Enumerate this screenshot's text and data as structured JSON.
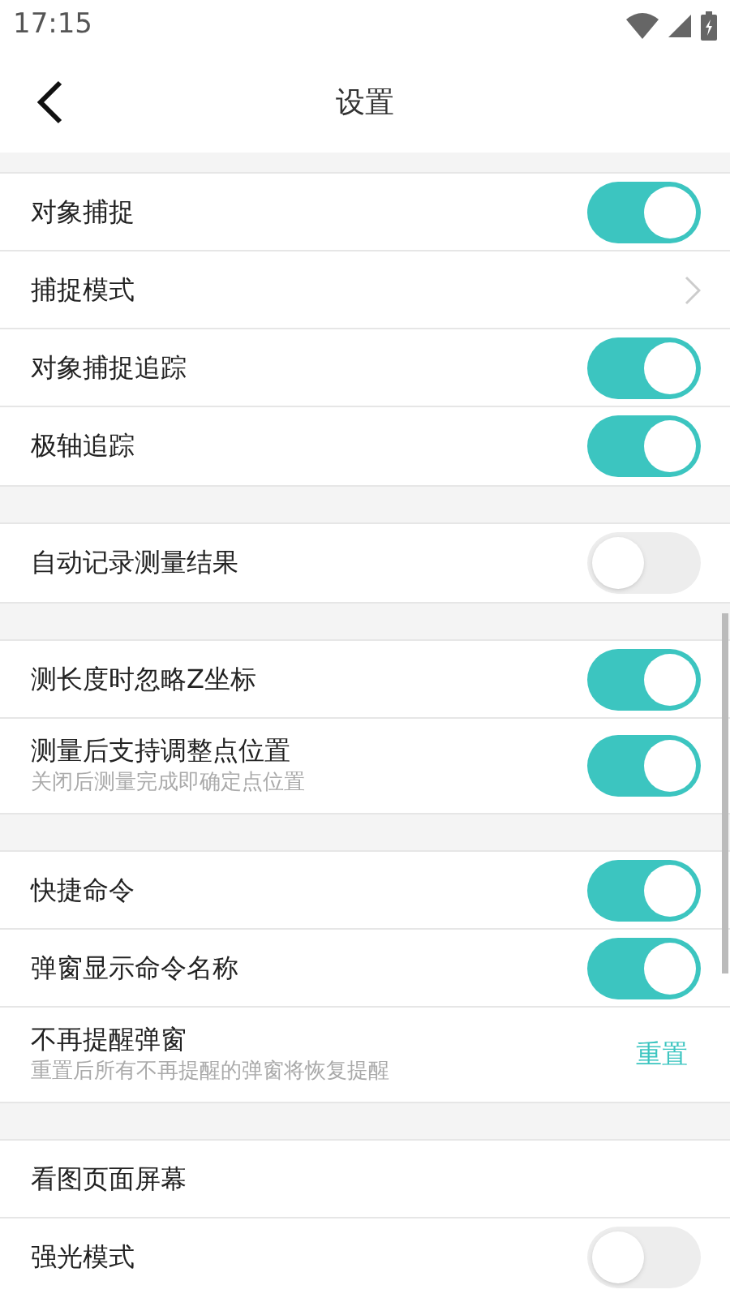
{
  "status_bar": {
    "time": "17:15"
  },
  "header": {
    "title": "设置"
  },
  "sections": [
    {
      "items": [
        {
          "kind": "toggle",
          "label": "对象捕捉",
          "on": true
        },
        {
          "kind": "link",
          "label": "捕捉模式"
        },
        {
          "kind": "toggle",
          "label": "对象捕捉追踪",
          "on": true
        },
        {
          "kind": "toggle",
          "label": "极轴追踪",
          "on": true
        }
      ]
    },
    {
      "items": [
        {
          "kind": "toggle",
          "label": "自动记录测量结果",
          "on": false
        }
      ]
    },
    {
      "items": [
        {
          "kind": "toggle",
          "label": "测长度时忽略Z坐标",
          "on": true
        },
        {
          "kind": "toggle",
          "label": "测量后支持调整点位置",
          "subtitle": "关闭后测量完成即确定点位置",
          "on": true
        }
      ]
    },
    {
      "items": [
        {
          "kind": "toggle",
          "label": "快捷命令",
          "on": true
        },
        {
          "kind": "toggle",
          "label": "弹窗显示命令名称",
          "on": true
        },
        {
          "kind": "action",
          "label": "不再提醒弹窗",
          "subtitle": "重置后所有不再提醒的弹窗将恢复提醒",
          "action": "重置"
        }
      ]
    },
    {
      "items": [
        {
          "kind": "plain",
          "label": "看图页面屏幕"
        },
        {
          "kind": "toggle",
          "label": "强光模式",
          "on": false
        }
      ]
    }
  ]
}
